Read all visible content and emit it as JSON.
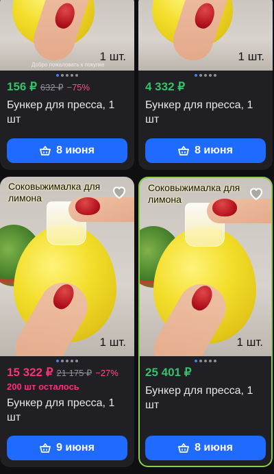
{
  "cards": [
    {
      "price": "156 ₽",
      "old_price": "632 ₽",
      "discount": "−75%",
      "title": "Бункер для пресса, 1 шт",
      "qty": "1 шт.",
      "watermark": "Добро пожаловать к покупке",
      "button": "8 июня",
      "dots_active": 1
    },
    {
      "price": "4 332 ₽",
      "title": "Бункер для пресса, 1 шт",
      "qty": "1 шт.",
      "button": "8 июня",
      "dots_active": 0
    },
    {
      "badge": "Соковыжималка для лимона",
      "price": "15 322 ₽",
      "old_price": "21 175 ₽",
      "discount": "−27%",
      "stock": "200 шт осталось",
      "title": "Бункер для пресса, 1 шт",
      "qty": "1 шт.",
      "button": "9 июня",
      "dots_active": 0
    },
    {
      "badge": "Соковыжималка для лимона",
      "price": "25 401 ₽",
      "title": "Бункер для пресса, 1 шт",
      "qty": "1 шт.",
      "button": "8 июня",
      "dots_active": 0
    }
  ],
  "colors": {
    "price_green": "#35c26a",
    "price_sale": "#ff2f7a",
    "button_blue": "#1f6bff",
    "selected_border": "#8ad04a"
  },
  "icons": {
    "cart": "basket-icon",
    "favorite": "heart-icon"
  }
}
